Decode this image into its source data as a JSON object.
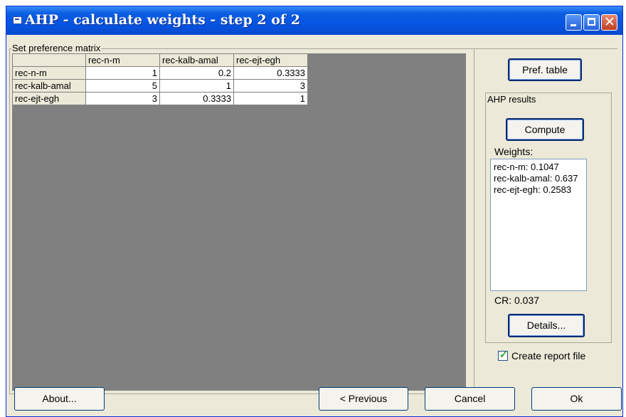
{
  "window": {
    "title": "AHP - calculate weights - step 2 of 2"
  },
  "matrix_group": {
    "label": "Set preference matrix",
    "columns": [
      "",
      "rec-n-m",
      "rec-kalb-amal",
      "rec-ejt-egh"
    ],
    "rows": [
      {
        "label": "rec-n-m",
        "cells": [
          "1",
          "0.2",
          "0.3333"
        ]
      },
      {
        "label": "rec-kalb-amal",
        "cells": [
          "5",
          "1",
          "3"
        ]
      },
      {
        "label": "rec-ejt-egh",
        "cells": [
          "3",
          "0.3333",
          "1"
        ]
      }
    ]
  },
  "pref_table_button": "Pref. table",
  "ahp_results": {
    "label": "AHP results",
    "compute_button": "Compute",
    "weights_label": "Weights:",
    "weights": [
      "rec-n-m: 0.1047",
      "rec-kalb-amal: 0.637",
      "rec-ejt-egh: 0.2583"
    ],
    "cr": "CR: 0.037",
    "details_button": "Details..."
  },
  "create_report": {
    "label": "Create report file",
    "checked": true
  },
  "footer": {
    "about": "About...",
    "previous": "< Previous",
    "cancel": "Cancel",
    "ok": "Ok"
  }
}
